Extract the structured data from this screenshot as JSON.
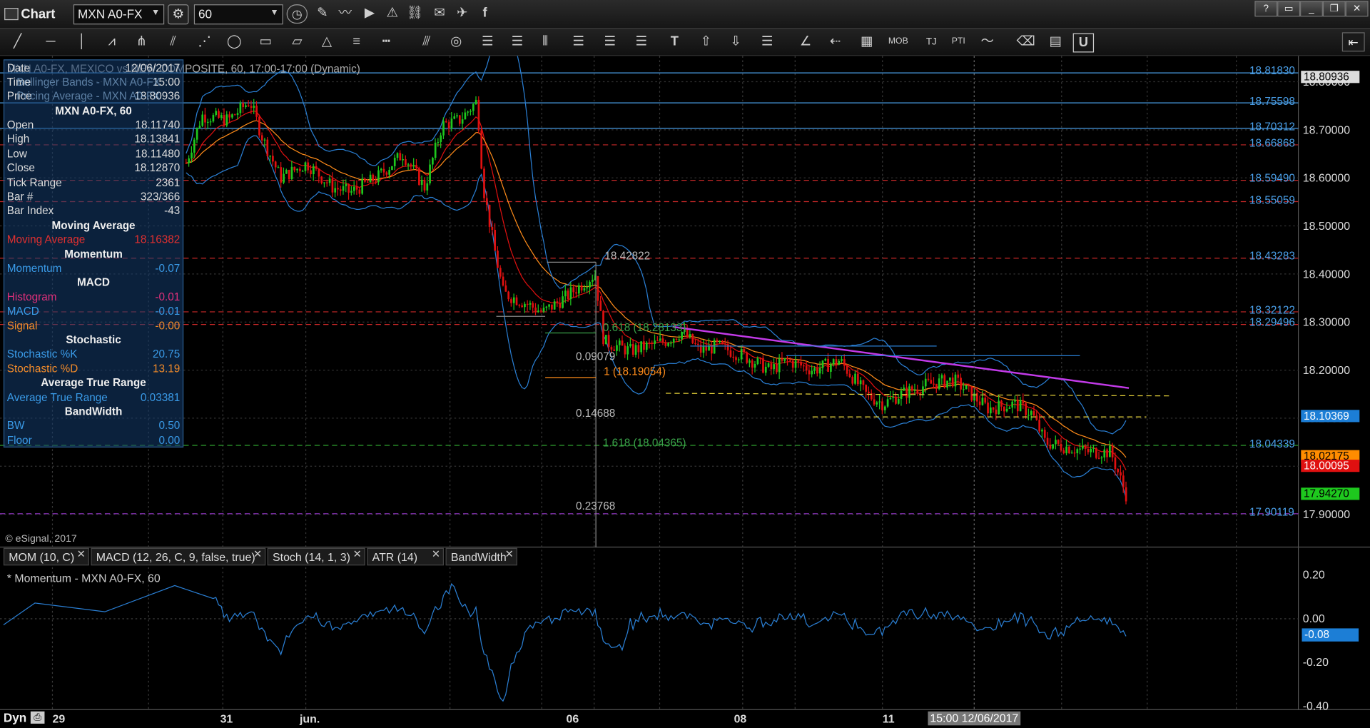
{
  "window": {
    "title": "Chart"
  },
  "titlebar": {
    "symbol": "MXN A0-FX",
    "interval": "60"
  },
  "toolbar": {
    "right_button": "⇤"
  },
  "chart": {
    "header": "MXN A0-FX, MEXICO vs NEW COMPOSITE, 60, 17:00-17:00 (Dynamic)",
    "overlay_lines": [
      "Date",
      "Time",
      "Bollinger Bands - MXN A0-FX",
      "Price",
      "Pricing Average - MXN A0-FX"
    ],
    "overlay_values": [
      "12/06/2017",
      "15:00",
      "18.80936"
    ],
    "copyright": "© eSignal, 2017",
    "price_labels": [
      {
        "text": "18.81830",
        "color": "#4a9fe8"
      },
      {
        "text": "18.75598",
        "color": "#4a9fe8"
      },
      {
        "text": "18.70312",
        "color": "#4a9fe8"
      },
      {
        "text": "18.66868",
        "color": "#4a9fe8"
      },
      {
        "text": "18.59490",
        "color": "#4a9fe8"
      },
      {
        "text": "18.55059",
        "color": "#4a9fe8"
      },
      {
        "text": "18.43283",
        "color": "#4a9fe8"
      },
      {
        "text": "18.32122",
        "color": "#4a9fe8"
      },
      {
        "text": "18.29496",
        "color": "#4a9fe8"
      },
      {
        "text": "18.04339",
        "color": "#4a9fe8"
      },
      {
        "text": "17.90119",
        "color": "#4a9fe8"
      }
    ],
    "fib_labels": {
      "high": "18.42822",
      "r0618": "0.618 (18.28133)",
      "r0": "0.09079",
      "r1": "1 (18.19054)",
      "r2": "0.14688",
      "r1618": "1.618 (18.04365)",
      "r3": "0.23768"
    },
    "axis_ticks": [
      "18.80000",
      "18.70000",
      "18.60000",
      "18.50000",
      "18.40000",
      "18.30000",
      "18.20000",
      "18.10000",
      "18.00000",
      "17.90000"
    ],
    "axis_boxes": [
      {
        "text": "18.80936",
        "bg": "#dddddd",
        "fg": "#000000"
      },
      {
        "text": "18.10369",
        "bg": "#1c7ed6",
        "fg": "#ffffff"
      },
      {
        "text": "18.02175",
        "bg": "#ff8c00",
        "fg": "#000000"
      },
      {
        "text": "18.00095",
        "bg": "#e01010",
        "fg": "#ffffff"
      },
      {
        "text": "17.94270",
        "bg": "#1ec81e",
        "fg": "#000000"
      }
    ]
  },
  "info_panel": {
    "title": "MXN A0-FX, 60",
    "rows": [
      {
        "label": "Open",
        "value": "18.11740"
      },
      {
        "label": "High",
        "value": "18.13841"
      },
      {
        "label": "Low",
        "value": "18.11480"
      },
      {
        "label": "Close",
        "value": "18.12870"
      },
      {
        "label": "Tick Range",
        "value": "2361"
      },
      {
        "label": "Bar #",
        "value": "323/366"
      },
      {
        "label": "Bar Index",
        "value": "-43"
      }
    ],
    "sections": [
      {
        "title": "Moving Average",
        "rows": [
          {
            "label": "Moving Average",
            "value": "18.16382",
            "color": "#e03030"
          }
        ]
      },
      {
        "title": "Momentum",
        "rows": [
          {
            "label": "Momentum",
            "value": "-0.07",
            "color": "#3a9be8"
          }
        ]
      },
      {
        "title": "MACD",
        "rows": [
          {
            "label": "Histogram",
            "value": "-0.01",
            "color": "#e0307a"
          },
          {
            "label": "MACD",
            "value": "-0.01",
            "color": "#3a9be8"
          },
          {
            "label": "Signal",
            "value": "-0.00",
            "color": "#f08a2a"
          }
        ]
      },
      {
        "title": "Stochastic",
        "rows": [
          {
            "label": "Stochastic %K",
            "value": "20.75",
            "color": "#3a9be8"
          },
          {
            "label": "Stochastic %D",
            "value": "13.19",
            "color": "#f08a2a"
          }
        ]
      },
      {
        "title": "Average True Range",
        "rows": [
          {
            "label": "Average True Range",
            "value": "0.03381",
            "color": "#3a9be8"
          }
        ]
      },
      {
        "title": "BandWidth",
        "rows": [
          {
            "label": "BW",
            "value": "0.50",
            "color": "#3a9be8"
          },
          {
            "label": "Floor",
            "value": "0.00",
            "color": "#3a9be8"
          }
        ]
      }
    ]
  },
  "tabs": [
    {
      "label": "MOM (10, C)"
    },
    {
      "label": "MACD (12, 26, C, 9, false, true)"
    },
    {
      "label": "Stoch (14, 1, 3)"
    },
    {
      "label": "ATR (14)"
    },
    {
      "label": "BandWidth"
    }
  ],
  "momentum_pane": {
    "title": "* Momentum - MXN A0-FX, 60",
    "ticks": [
      "0.20",
      "0.00",
      "-0.20",
      "-0.40"
    ],
    "current": "-0.08"
  },
  "x_axis": {
    "mode": "Dyn",
    "labels": [
      "29",
      "31",
      "jun.",
      "06",
      "08",
      "11"
    ],
    "crosshair_label": "15:00 12/06/2017"
  }
}
